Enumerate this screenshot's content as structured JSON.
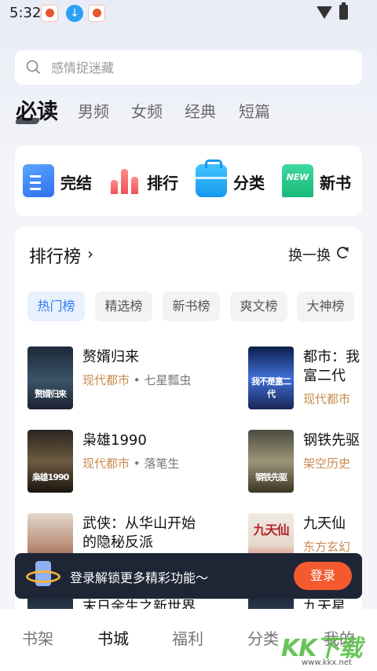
{
  "status_bar": {
    "time": "5:32"
  },
  "search": {
    "placeholder": "感情捉迷藏"
  },
  "category_tabs": [
    {
      "label": "必读",
      "active": true
    },
    {
      "label": "男频",
      "active": false
    },
    {
      "label": "女频",
      "active": false
    },
    {
      "label": "经典",
      "active": false
    },
    {
      "label": "短篇",
      "active": false
    }
  ],
  "quick_entries": [
    {
      "label": "完结",
      "icon": "document-list-icon"
    },
    {
      "label": "排行",
      "icon": "bar-rank-icon"
    },
    {
      "label": "分类",
      "icon": "toolbox-icon"
    },
    {
      "label": "新书",
      "icon": "new-badge-icon",
      "badge": "NEW"
    }
  ],
  "rank_section": {
    "title": "排行榜",
    "arrow": "›",
    "swap_label": "换一换",
    "chips": [
      {
        "label": "热门榜",
        "active": true
      },
      {
        "label": "精选榜",
        "active": false
      },
      {
        "label": "新书榜",
        "active": false
      },
      {
        "label": "爽文榜",
        "active": false
      },
      {
        "label": "大神榜",
        "active": false
      }
    ],
    "books_left": [
      {
        "title": "赘婿归来",
        "genre": "现代都市",
        "author": "七星瓢虫",
        "cover_text": "赘婿归来"
      },
      {
        "title": "枭雄1990",
        "genre": "现代都市",
        "author": "落笔生",
        "cover_text": "枭雄1990"
      },
      {
        "title": "武侠：从华山开始",
        "title2": "的隐秘反派",
        "genre": "",
        "author": "",
        "cover_text": ""
      },
      {
        "title": "末日余生之新世界",
        "genre": "",
        "author": ""
      }
    ],
    "books_right": [
      {
        "title": "都市：我",
        "title2": "富二代",
        "genre": "现代都市",
        "cover_text": "我不是富二代"
      },
      {
        "title": "钢铁先驱",
        "genre": "架空历史",
        "cover_text": "钢铁先驱"
      },
      {
        "title": "九天仙",
        "genre": "东方玄幻",
        "cover_text": "九天仙"
      },
      {
        "title": "九天星"
      }
    ],
    "separator": "•"
  },
  "login_banner": {
    "text": "登录解锁更多精彩功能～",
    "button": "登录"
  },
  "bottom_nav": [
    {
      "label": "书架",
      "active": false
    },
    {
      "label": "书城",
      "active": true
    },
    {
      "label": "福利",
      "active": false
    },
    {
      "label": "分类",
      "active": false
    },
    {
      "label": "我的",
      "active": false
    }
  ],
  "watermark": {
    "text": "KK下载",
    "url": "www.kkx.net"
  }
}
